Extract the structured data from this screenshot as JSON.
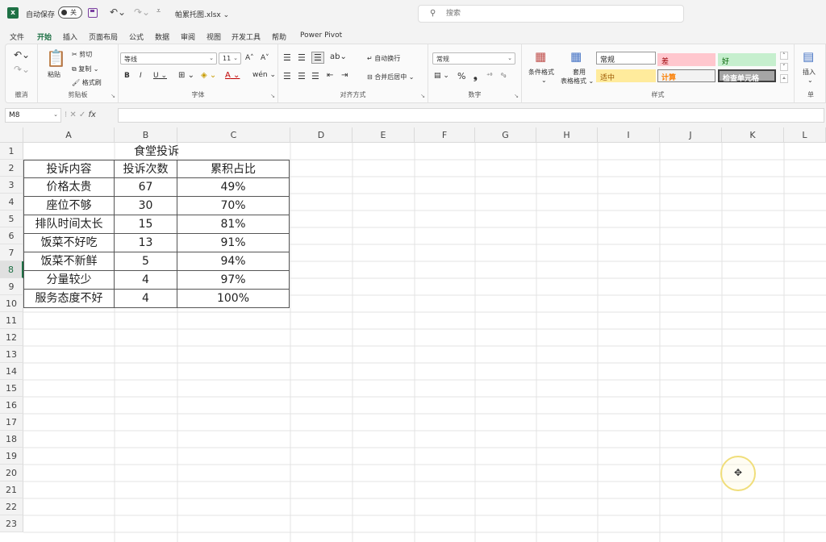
{
  "titlebar": {
    "autosave_label": "自动保存",
    "autosave_state": "关",
    "filename": "帕累托图.xlsx ⌄",
    "search_placeholder": "搜索"
  },
  "menu": {
    "tabs": [
      "文件",
      "开始",
      "插入",
      "页面布局",
      "公式",
      "数据",
      "审阅",
      "视图",
      "开发工具",
      "帮助",
      "Power Pivot"
    ],
    "active": "开始"
  },
  "ribbon": {
    "undo_label": "撤消",
    "clipboard": {
      "paste": "粘贴",
      "cut": "剪切",
      "copy": "复制",
      "format_painter": "格式刷",
      "label": "剪贴板"
    },
    "font": {
      "name": "等线",
      "size": "11",
      "grow": "A˄",
      "shrink": "A˅",
      "bold": "B",
      "italic": "I",
      "underline": "U",
      "wen": "wén",
      "label": "字体"
    },
    "alignment": {
      "wrap": "自动换行",
      "merge": "合并后居中",
      "label": "对齐方式"
    },
    "number": {
      "format": "常规",
      "percent": "%",
      "comma": "❟",
      "label": "数字"
    },
    "styles": {
      "conditional": "条件格式",
      "table_format_1": "套用",
      "table_format_2": "表格格式",
      "normal": "常规",
      "bad": "差",
      "good": "好",
      "neutral": "适中",
      "calculation": "计算",
      "check_cell": "检查单元格",
      "label": "样式"
    },
    "cells": {
      "insert": "插入",
      "label": "单"
    }
  },
  "formula_bar": {
    "name_box": "M8",
    "fx": "fx",
    "value": ""
  },
  "grid": {
    "columns": [
      "A",
      "B",
      "C",
      "D",
      "E",
      "F",
      "G",
      "H",
      "I",
      "J",
      "K",
      "L"
    ],
    "rows": [
      "1",
      "2",
      "3",
      "4",
      "5",
      "6",
      "7",
      "8",
      "9",
      "10",
      "11",
      "12",
      "13",
      "14",
      "15",
      "16",
      "17",
      "18",
      "19",
      "20",
      "21",
      "22",
      "23"
    ],
    "selected_row": "8"
  },
  "sheet": {
    "title": "食堂投诉",
    "headers": [
      "投诉内容",
      "投诉次数",
      "累积占比"
    ],
    "rows": [
      [
        "价格太贵",
        "67",
        "49%"
      ],
      [
        "座位不够",
        "30",
        "70%"
      ],
      [
        "排队时间太长",
        "15",
        "81%"
      ],
      [
        "饭菜不好吃",
        "13",
        "91%"
      ],
      [
        "饭菜不新鲜",
        "5",
        "94%"
      ],
      [
        "分量较少",
        "4",
        "97%"
      ],
      [
        "服务态度不好",
        "4",
        "100%"
      ]
    ]
  },
  "colors": {
    "accent": "#1e7145",
    "header_orange": "#f57f2a",
    "header_blue": "#4472c4"
  }
}
